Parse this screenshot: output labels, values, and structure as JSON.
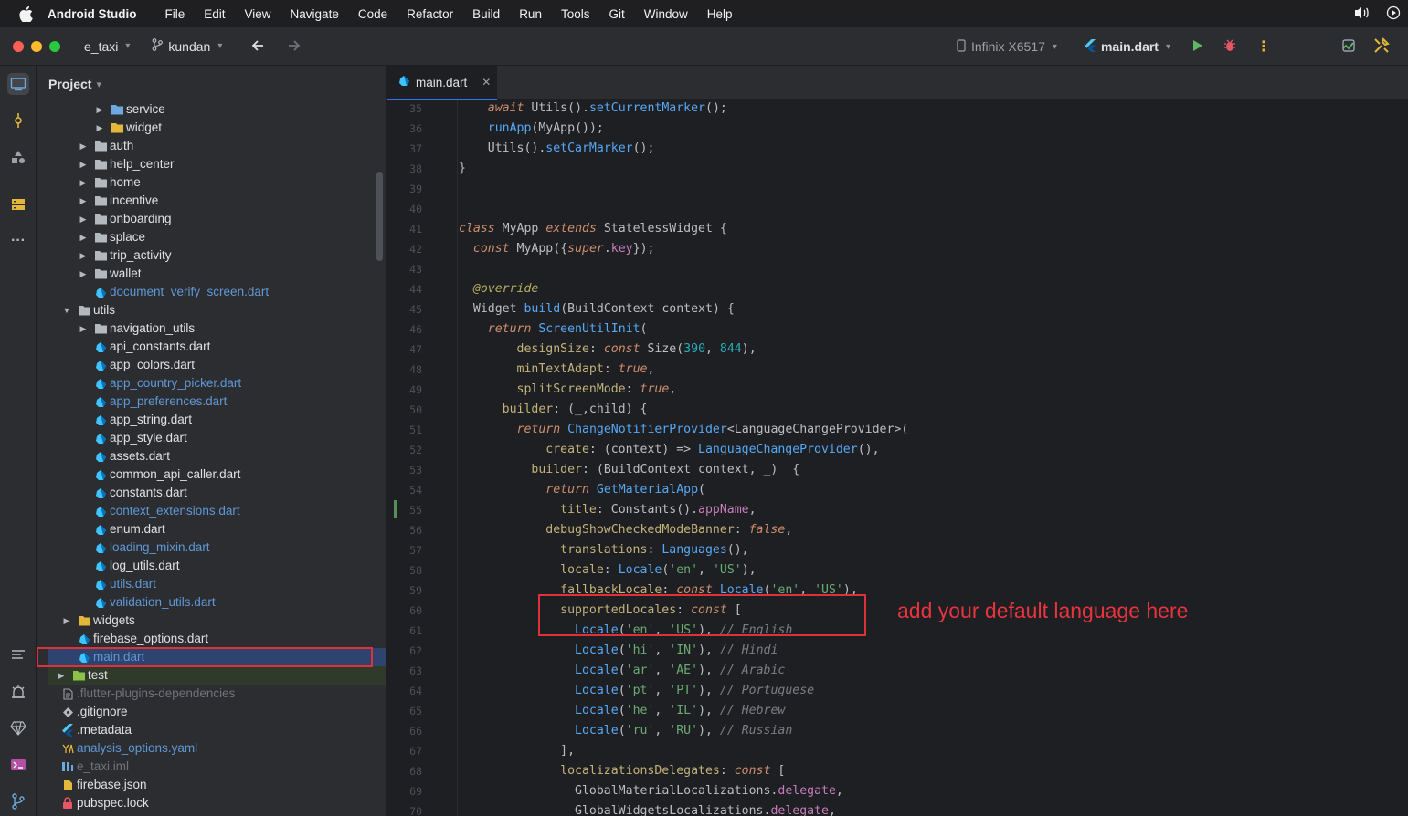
{
  "menubar": {
    "app_name": "Android Studio",
    "items": [
      "File",
      "Edit",
      "View",
      "Navigate",
      "Code",
      "Refactor",
      "Build",
      "Run",
      "Tools",
      "Git",
      "Window",
      "Help"
    ]
  },
  "toolbar": {
    "project_name": "e_taxi",
    "branch": "kundan",
    "device": "Infinix X6517",
    "run_config": "main.dart"
  },
  "project_panel": {
    "title": "Project",
    "tree": [
      {
        "label": "service",
        "depth": 4,
        "arrow": true,
        "icon": "service-folder-icon"
      },
      {
        "label": "widget",
        "depth": 4,
        "arrow": true,
        "icon": "widget-folder-icon"
      },
      {
        "label": "auth",
        "depth": 3,
        "arrow": true,
        "icon": "folder-icon"
      },
      {
        "label": "help_center",
        "depth": 3,
        "arrow": true,
        "icon": "folder-icon"
      },
      {
        "label": "home",
        "depth": 3,
        "arrow": true,
        "icon": "folder-icon"
      },
      {
        "label": "incentive",
        "depth": 3,
        "arrow": true,
        "icon": "folder-icon"
      },
      {
        "label": "onboarding",
        "depth": 3,
        "arrow": true,
        "icon": "folder-icon"
      },
      {
        "label": "splace",
        "depth": 3,
        "arrow": true,
        "icon": "folder-icon"
      },
      {
        "label": "trip_activity",
        "depth": 3,
        "arrow": true,
        "icon": "folder-icon"
      },
      {
        "label": "wallet",
        "depth": 3,
        "arrow": true,
        "icon": "folder-icon"
      },
      {
        "label": "document_verify_screen.dart",
        "depth": 3,
        "arrow": false,
        "icon": "dart-file-icon",
        "status": "modified"
      },
      {
        "label": "utils",
        "depth": 2,
        "arrow": "open",
        "icon": "folder-icon"
      },
      {
        "label": "navigation_utils",
        "depth": 3,
        "arrow": true,
        "icon": "folder-icon"
      },
      {
        "label": "api_constants.dart",
        "depth": 3,
        "arrow": false,
        "icon": "dart-file-icon"
      },
      {
        "label": "app_colors.dart",
        "depth": 3,
        "arrow": false,
        "icon": "dart-file-icon"
      },
      {
        "label": "app_country_picker.dart",
        "depth": 3,
        "arrow": false,
        "icon": "dart-file-icon",
        "status": "modified"
      },
      {
        "label": "app_preferences.dart",
        "depth": 3,
        "arrow": false,
        "icon": "dart-file-icon",
        "status": "modified"
      },
      {
        "label": "app_string.dart",
        "depth": 3,
        "arrow": false,
        "icon": "dart-file-icon"
      },
      {
        "label": "app_style.dart",
        "depth": 3,
        "arrow": false,
        "icon": "dart-file-icon"
      },
      {
        "label": "assets.dart",
        "depth": 3,
        "arrow": false,
        "icon": "dart-file-icon"
      },
      {
        "label": "common_api_caller.dart",
        "depth": 3,
        "arrow": false,
        "icon": "dart-file-icon"
      },
      {
        "label": "constants.dart",
        "depth": 3,
        "arrow": false,
        "icon": "dart-file-icon"
      },
      {
        "label": "context_extensions.dart",
        "depth": 3,
        "arrow": false,
        "icon": "dart-file-icon",
        "status": "modified"
      },
      {
        "label": "enum.dart",
        "depth": 3,
        "arrow": false,
        "icon": "dart-file-icon"
      },
      {
        "label": "loading_mixin.dart",
        "depth": 3,
        "arrow": false,
        "icon": "dart-file-icon",
        "status": "modified"
      },
      {
        "label": "log_utils.dart",
        "depth": 3,
        "arrow": false,
        "icon": "dart-file-icon"
      },
      {
        "label": "utils.dart",
        "depth": 3,
        "arrow": false,
        "icon": "dart-file-icon",
        "status": "modified"
      },
      {
        "label": "validation_utils.dart",
        "depth": 3,
        "arrow": false,
        "icon": "dart-file-icon",
        "status": "modified"
      },
      {
        "label": "widgets",
        "depth": 2,
        "arrow": true,
        "icon": "widget-folder-icon"
      },
      {
        "label": "firebase_options.dart",
        "depth": 2,
        "arrow": false,
        "icon": "dart-file-icon"
      },
      {
        "label": "main.dart",
        "depth": 2,
        "arrow": false,
        "icon": "dart-file-icon",
        "status": "modified",
        "selected": true
      },
      {
        "label": "test",
        "depth": 1,
        "arrow": true,
        "icon": "test-folder-icon",
        "status": "test"
      },
      {
        "label": ".flutter-plugins-dependencies",
        "depth": 1,
        "arrow": false,
        "icon": "text-file-icon",
        "status": "ignored"
      },
      {
        "label": ".gitignore",
        "depth": 1,
        "arrow": false,
        "icon": "gitignore-icon"
      },
      {
        "label": ".metadata",
        "depth": 1,
        "arrow": false,
        "icon": "flutter-icon"
      },
      {
        "label": "analysis_options.yaml",
        "depth": 1,
        "arrow": false,
        "icon": "yaml-icon",
        "status": "modified"
      },
      {
        "label": "e_taxi.iml",
        "depth": 1,
        "arrow": false,
        "icon": "iml-icon",
        "status": "ignored"
      },
      {
        "label": "firebase.json",
        "depth": 1,
        "arrow": false,
        "icon": "json-icon"
      },
      {
        "label": "pubspec.lock",
        "depth": 1,
        "arrow": false,
        "icon": "lock-icon"
      }
    ]
  },
  "editor": {
    "tab_label": "main.dart",
    "annotation": "add your default language  here",
    "lines": [
      {
        "n": "35",
        "html": "    <span class='kw'>await</span> <span class='typ'>Utils</span>().<span class='fn'>setCurrentMarker</span>();"
      },
      {
        "n": "36",
        "html": "    <span class='fn'>runApp</span>(<span class='typ'>MyApp</span>());"
      },
      {
        "n": "37",
        "html": "    <span class='typ'>Utils</span>().<span class='fn'>setCarMarker</span>();"
      },
      {
        "n": "38",
        "html": "}"
      },
      {
        "n": "39",
        "html": ""
      },
      {
        "n": "40",
        "html": ""
      },
      {
        "n": "41",
        "html": "<span class='kw'>class</span> <span class='typ'>MyApp</span> <span class='kw'>extends</span> <span class='typ'>StatelessWidget</span> {"
      },
      {
        "n": "42",
        "html": "  <span class='kw'>const</span> <span class='typ'>MyApp</span>({<span class='kw'>super</span>.<span class='fld'>key</span>});"
      },
      {
        "n": "43",
        "html": ""
      },
      {
        "n": "44",
        "html": "  <span class='ann'>@override</span>"
      },
      {
        "n": "45",
        "html": "  <span class='typ'>Widget</span> <span class='fn'>build</span>(<span class='typ'>BuildContext</span> context) {"
      },
      {
        "n": "46",
        "html": "    <span class='kw'>return</span> <span class='fn'>ScreenUtilInit</span>("
      },
      {
        "n": "47",
        "html": "        <span class='named'>designSize</span>: <span class='kw'>const</span> <span class='typ'>Size</span>(<span class='num'>390</span>, <span class='num'>844</span>),"
      },
      {
        "n": "48",
        "html": "        <span class='named'>minTextAdapt</span>: <span class='kw'>true</span>,"
      },
      {
        "n": "49",
        "html": "        <span class='named'>splitScreenMode</span>: <span class='kw'>true</span>,"
      },
      {
        "n": "50",
        "html": "      <span class='named'>builder</span>: (_,child) {"
      },
      {
        "n": "51",
        "html": "        <span class='kw'>return</span> <span class='fn'>ChangeNotifierProvider</span>&lt;<span class='typ'>LanguageChangeProvider</span>&gt;("
      },
      {
        "n": "52",
        "html": "            <span class='named'>create</span>: (context) =&gt; <span class='fn'>LanguageChangeProvider</span>(),"
      },
      {
        "n": "53",
        "html": "          <span class='named'>builder</span>: (<span class='typ'>BuildContext</span> context, _)  {"
      },
      {
        "n": "54",
        "html": "            <span class='kw'>return</span> <span class='fn'>GetMaterialApp</span>("
      },
      {
        "n": "55",
        "html": "              <span class='named'>title</span>: <span class='typ'>Constants</span>().<span class='fld'>appName</span>,"
      },
      {
        "n": "56",
        "html": "            <span class='named'>debugShowCheckedModeBanner</span>: <span class='kw'>false</span>,"
      },
      {
        "n": "57",
        "html": "              <span class='named'>translations</span>: <span class='fn'>Languages</span>(),"
      },
      {
        "n": "58",
        "html": "              <span class='named'>locale</span>: <span class='fn'>Locale</span>(<span class='str'>'en'</span>, <span class='str'>'US'</span>),"
      },
      {
        "n": "59",
        "html": "              <span class='named'>fallbackLocale</span>: <span class='kw'>const</span> <span class='fn'>Locale</span>(<span class='str'>'en'</span>, <span class='str'>'US'</span>),"
      },
      {
        "n": "60",
        "html": "              <span class='named'>supportedLocales</span>: <span class='kw'>const</span> ["
      },
      {
        "n": "61",
        "html": "                <span class='fn'>Locale</span>(<span class='str'>'en'</span>, <span class='str'>'US'</span>), <span class='cmt'>// English</span>"
      },
      {
        "n": "62",
        "html": "                <span class='fn'>Locale</span>(<span class='str'>'hi'</span>, <span class='str'>'IN'</span>), <span class='cmt'>// Hindi</span>"
      },
      {
        "n": "63",
        "html": "                <span class='fn'>Locale</span>(<span class='str'>'ar'</span>, <span class='str'>'AE'</span>), <span class='cmt'>// Arabic</span>"
      },
      {
        "n": "64",
        "html": "                <span class='fn'>Locale</span>(<span class='str'>'pt'</span>, <span class='str'>'PT'</span>), <span class='cmt'>// Portuguese</span>"
      },
      {
        "n": "65",
        "html": "                <span class='fn'>Locale</span>(<span class='str'>'he'</span>, <span class='str'>'IL'</span>), <span class='cmt'>// Hebrew</span>"
      },
      {
        "n": "66",
        "html": "                <span class='fn'>Locale</span>(<span class='str'>'ru'</span>, <span class='str'>'RU'</span>), <span class='cmt'>// Russian</span>"
      },
      {
        "n": "67",
        "html": "              ],"
      },
      {
        "n": "68",
        "html": "              <span class='named'>localizationsDelegates</span>: <span class='kw'>const</span> ["
      },
      {
        "n": "69",
        "html": "                <span class='typ'>GlobalMaterialLocalizations</span>.<span class='fld'>delegate</span>,"
      },
      {
        "n": "70",
        "html": "                <span class='typ'>GlobalWidgetsLocalizations</span>.<span class='fld'>delegate</span>,"
      }
    ]
  },
  "colors": {
    "accent": "#3574f0",
    "highlight_red": "#e0303a"
  }
}
